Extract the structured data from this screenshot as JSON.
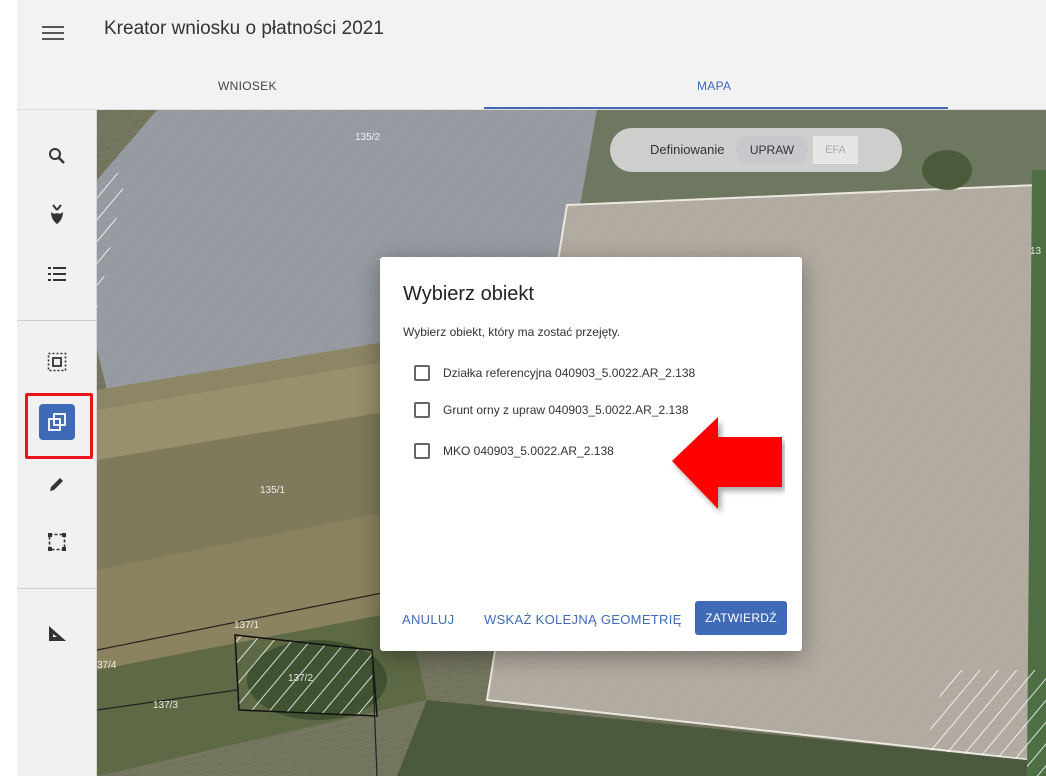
{
  "app": {
    "title": "Kreator wniosku o płatności 2021"
  },
  "tabs": [
    {
      "label": "WNIOSEK",
      "active": false
    },
    {
      "label": "MAPA",
      "active": true
    }
  ],
  "sidebar": {
    "tools": [
      {
        "name": "search-icon"
      },
      {
        "name": "plant-icon"
      },
      {
        "name": "list-icon"
      },
      {
        "name": "select-area-icon"
      },
      {
        "name": "copy-geometry-icon",
        "active": true
      },
      {
        "name": "pencil-icon"
      },
      {
        "name": "bounding-box-icon"
      },
      {
        "name": "measure-icon"
      }
    ]
  },
  "map": {
    "mode_label": "Definiowanie",
    "mode_upraw": "UPRAW",
    "mode_efa": "EFA",
    "parcel_labels": [
      "135/2",
      "135/1",
      "137/1",
      "37/4",
      "137/2",
      "137/3",
      "13"
    ]
  },
  "dialog": {
    "title": "Wybierz obiekt",
    "subtitle": "Wybierz obiekt, który ma zostać przejęty.",
    "options": [
      {
        "label": "Działka referencyjna 040903_5.0022.AR_2.138",
        "checked": false
      },
      {
        "label": "Grunt orny z upraw 040903_5.0022.AR_2.138",
        "checked": false
      },
      {
        "label": "MKO 040903_5.0022.AR_2.138",
        "checked": false
      }
    ],
    "cancel_label": "ANULUJ",
    "next_label": "WSKAŻ KOLEJNĄ GEOMETRIĘ",
    "confirm_label": "ZATWIERDŹ"
  },
  "colors": {
    "accent": "#3f6ab7",
    "highlight": "#e8141c"
  }
}
